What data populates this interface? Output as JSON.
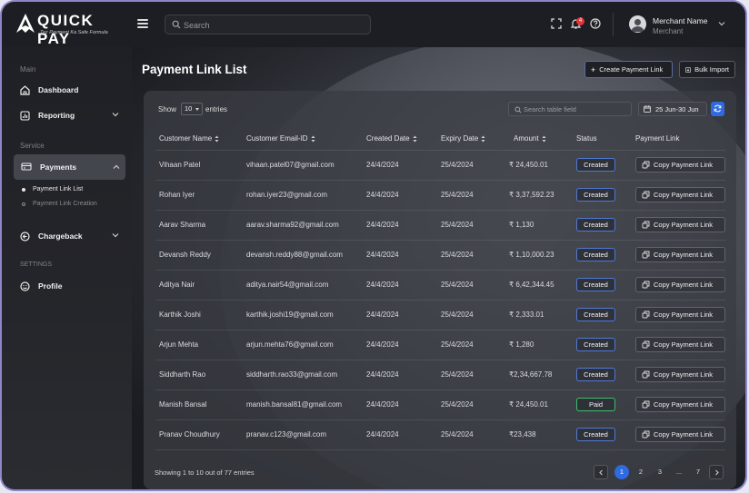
{
  "app": {
    "name": "QUICK PAY",
    "tagline": "Tez Payment Ka Safe Formula"
  },
  "header": {
    "search_placeholder": "Search",
    "notification_count": "4",
    "user_name": "Merchant Name",
    "user_role": "Merchant"
  },
  "sidebar": {
    "section_main": "Main",
    "dashboard": "Dashboard",
    "reporting": "Reporting",
    "section_service": "Service",
    "payments": "Payments",
    "payment_link_list": "Payment Link List",
    "payment_link_creation": "Payment Link Creation",
    "chargeback": "Chargeback",
    "section_settings": "SETTINGS",
    "profile": "Profile"
  },
  "page": {
    "title": "Payment Link List",
    "create_button": "Create Payment Link",
    "bulk_button": "Bulk Import"
  },
  "table_controls": {
    "show_label": "Show",
    "entries_value": "10",
    "entries_label": "entries",
    "search_placeholder": "Search table field",
    "date_range": "25 Jun-30 Jun"
  },
  "table": {
    "columns": [
      "Customer Name",
      "Customer Email-ID",
      "Created Date",
      "Expiry Date",
      "Amount",
      "Status",
      "Payment Link"
    ],
    "copy_label": "Copy Payment Link",
    "rows": [
      {
        "name": "Vihaan Patel",
        "email": "vihaan.patel07@gmail.com",
        "created": "24/4/2024",
        "expiry": "25/4/2024",
        "amount": "₹ 24,450.01",
        "status": "Created"
      },
      {
        "name": "Rohan Iyer",
        "email": "rohan.iyer23@gmail.com",
        "created": "24/4/2024",
        "expiry": "25/4/2024",
        "amount": "₹ 3,37,592.23",
        "status": "Created"
      },
      {
        "name": "Aarav Sharma",
        "email": "aarav.sharma92@gmail.com",
        "created": "24/4/2024",
        "expiry": "25/4/2024",
        "amount": "₹ 1,130",
        "status": "Created"
      },
      {
        "name": "Devansh Reddy",
        "email": "devansh.reddy88@gmail.com",
        "created": "24/4/2024",
        "expiry": "25/4/2024",
        "amount": "₹ 1,10,000.23",
        "status": "Created"
      },
      {
        "name": "Aditya Nair",
        "email": "aditya.nair54@gmail.com",
        "created": "24/4/2024",
        "expiry": "25/4/2024",
        "amount": "₹ 6,42,344.45",
        "status": "Created"
      },
      {
        "name": "Karthik Joshi",
        "email": "karthik.joshi19@gmail.com",
        "created": "24/4/2024",
        "expiry": "25/4/2024",
        "amount": "₹ 2,333.01",
        "status": "Created"
      },
      {
        "name": "Arjun Mehta",
        "email": "arjun.mehta76@gmail.com",
        "created": "24/4/2024",
        "expiry": "25/4/2024",
        "amount": "₹ 1,280",
        "status": "Created"
      },
      {
        "name": "Siddharth Rao",
        "email": "siddharth.rao33@gmail.com",
        "created": "24/4/2024",
        "expiry": "25/4/2024",
        "amount": "₹2,34,667.78",
        "status": "Created"
      },
      {
        "name": "Manish Bansal",
        "email": "manish.bansal81@gmail.com",
        "created": "24/4/2024",
        "expiry": "25/4/2024",
        "amount": "₹ 24,450.01",
        "status": "Paid"
      },
      {
        "name": "Pranav Choudhury",
        "email": "pranav.c123@gmail.com",
        "created": "24/4/2024",
        "expiry": "25/4/2024",
        "amount": "₹23,438",
        "status": "Created"
      }
    ]
  },
  "footer": {
    "showing_text": "Showing 1 to 10 out of 77 entries",
    "pages": [
      "1",
      "2",
      "3",
      "...",
      "7"
    ],
    "current_page": "1"
  },
  "colors": {
    "accent": "#2f6ae0",
    "created_border": "#4f78d6",
    "paid_border": "#3ebd6a",
    "notification": "#e53535"
  },
  "icons": {
    "logo": "logo-icon",
    "menu": "hamburger-icon",
    "search": "search-icon",
    "fullscreen": "fullscreen-icon",
    "notifications": "bell-icon",
    "help": "help-icon",
    "calendar": "calendar-icon",
    "refresh": "refresh-icon",
    "copy": "copy-icon"
  }
}
